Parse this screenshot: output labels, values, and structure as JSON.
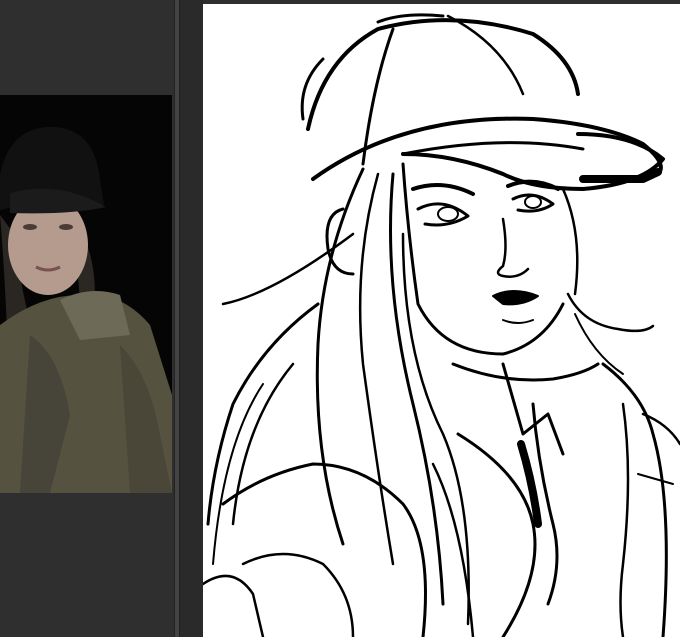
{
  "app": {
    "reference_panel": {
      "image_icon": "reference-photo"
    },
    "canvas": {
      "content_icon": "line-sketch"
    }
  },
  "colors": {
    "workspace_background": "#2e2e2e",
    "splitter": "#444444",
    "canvas_background": "#ffffff",
    "ink": "#000000",
    "reference_background": "#050505",
    "jacket": "#55523f"
  }
}
